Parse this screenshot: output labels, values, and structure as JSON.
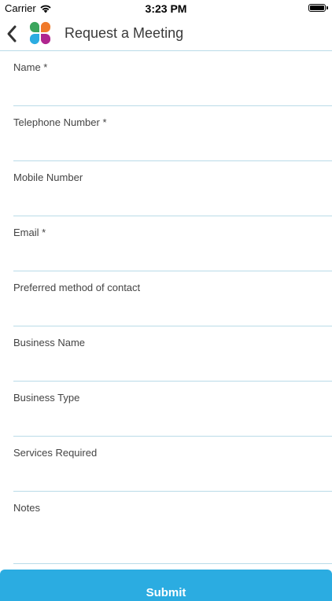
{
  "status_bar": {
    "carrier": "Carrier",
    "time": "3:23 PM",
    "wifi_icon": "wifi-icon",
    "battery_icon": "battery-icon"
  },
  "nav": {
    "title": "Request a Meeting",
    "back_icon": "chevron-left-icon",
    "logo_icon": "four-petal-logo",
    "logo_colors": [
      "#3aa55c",
      "#f07a2b",
      "#2bace1",
      "#b0268f"
    ]
  },
  "form": {
    "fields": [
      {
        "label": "Name *",
        "value": "",
        "placeholder": ""
      },
      {
        "label": "Telephone Number *",
        "value": "",
        "placeholder": ""
      },
      {
        "label": "Mobile Number",
        "value": "",
        "placeholder": ""
      },
      {
        "label": "Email *",
        "value": "",
        "placeholder": ""
      },
      {
        "label": "Preferred method of contact",
        "value": "",
        "placeholder": ""
      },
      {
        "label": "Business Name",
        "value": "",
        "placeholder": ""
      },
      {
        "label": "Business Type",
        "value": "",
        "placeholder": ""
      },
      {
        "label": "Services Required",
        "value": "",
        "placeholder": ""
      },
      {
        "label": "Notes",
        "value": "",
        "placeholder": ""
      }
    ]
  },
  "submit": {
    "label": "Submit",
    "color": "#2bace1"
  },
  "colors": {
    "divider": "#b9dbe8",
    "accent": "#2bace1"
  }
}
